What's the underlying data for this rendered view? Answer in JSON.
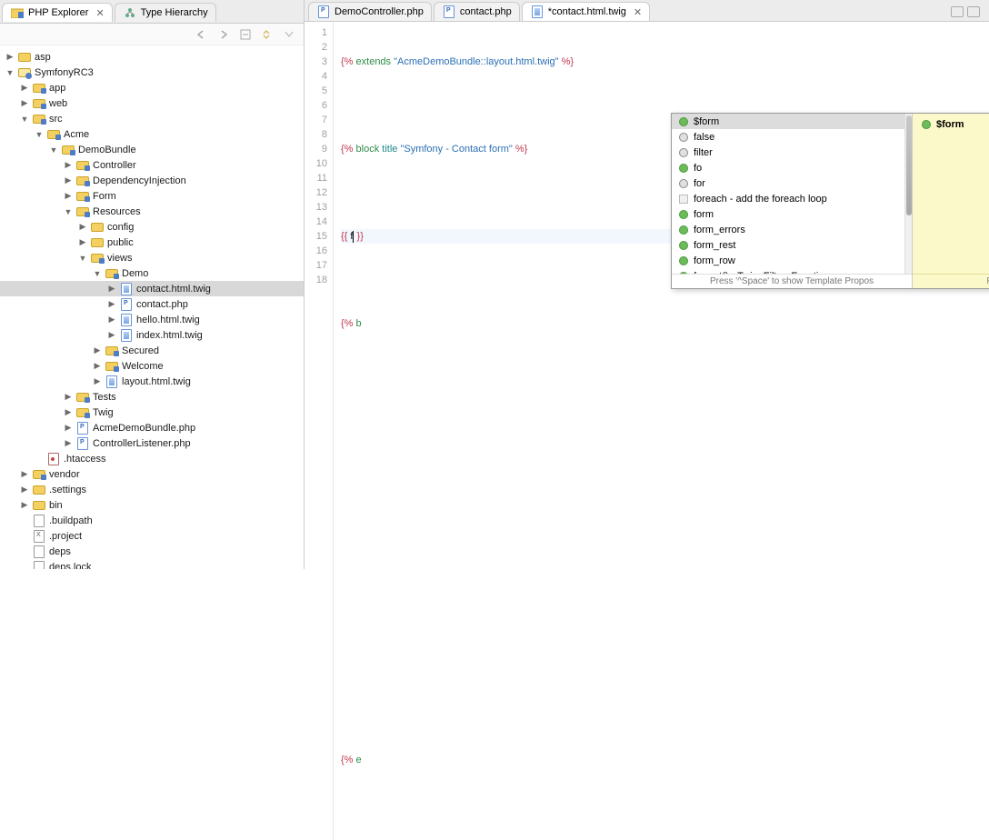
{
  "left": {
    "tabs": [
      {
        "label": "PHP Explorer",
        "active": true
      },
      {
        "label": "Type Hierarchy",
        "active": false
      }
    ],
    "tree": [
      {
        "d": 0,
        "arrow": "▶",
        "icon": "folder-closed",
        "label": "asp"
      },
      {
        "d": 0,
        "arrow": "▼",
        "icon": "proj-icon",
        "label": "SymfonyRC3"
      },
      {
        "d": 1,
        "arrow": "▶",
        "icon": "php-folder",
        "label": "app"
      },
      {
        "d": 1,
        "arrow": "▶",
        "icon": "php-folder",
        "label": "web"
      },
      {
        "d": 1,
        "arrow": "▼",
        "icon": "php-folder",
        "label": "src"
      },
      {
        "d": 2,
        "arrow": "▼",
        "icon": "php-folder",
        "label": "Acme"
      },
      {
        "d": 3,
        "arrow": "▼",
        "icon": "php-folder",
        "label": "DemoBundle"
      },
      {
        "d": 4,
        "arrow": "▶",
        "icon": "php-folder",
        "label": "Controller"
      },
      {
        "d": 4,
        "arrow": "▶",
        "icon": "php-folder",
        "label": "DependencyInjection"
      },
      {
        "d": 4,
        "arrow": "▶",
        "icon": "php-folder",
        "label": "Form"
      },
      {
        "d": 4,
        "arrow": "▼",
        "icon": "php-folder",
        "label": "Resources"
      },
      {
        "d": 5,
        "arrow": "▶",
        "icon": "folder-closed",
        "label": "config"
      },
      {
        "d": 5,
        "arrow": "▶",
        "icon": "folder-closed",
        "label": "public"
      },
      {
        "d": 5,
        "arrow": "▼",
        "icon": "php-folder",
        "label": "views"
      },
      {
        "d": 6,
        "arrow": "▼",
        "icon": "php-folder",
        "label": "Demo"
      },
      {
        "d": 7,
        "arrow": "▶",
        "icon": "file-t",
        "label": "contact.html.twig",
        "selected": true
      },
      {
        "d": 7,
        "arrow": "▶",
        "icon": "file-p",
        "label": "contact.php"
      },
      {
        "d": 7,
        "arrow": "▶",
        "icon": "file-t",
        "label": "hello.html.twig"
      },
      {
        "d": 7,
        "arrow": "▶",
        "icon": "file-t",
        "label": "index.html.twig"
      },
      {
        "d": 6,
        "arrow": "▶",
        "icon": "php-folder",
        "label": "Secured"
      },
      {
        "d": 6,
        "arrow": "▶",
        "icon": "php-folder",
        "label": "Welcome"
      },
      {
        "d": 6,
        "arrow": "▶",
        "icon": "file-t",
        "label": "layout.html.twig"
      },
      {
        "d": 4,
        "arrow": "▶",
        "icon": "php-folder",
        "label": "Tests"
      },
      {
        "d": 4,
        "arrow": "▶",
        "icon": "php-folder",
        "label": "Twig"
      },
      {
        "d": 4,
        "arrow": "▶",
        "icon": "file-p",
        "label": "AcmeDemoBundle.php"
      },
      {
        "d": 4,
        "arrow": "▶",
        "icon": "file-p",
        "label": "ControllerListener.php"
      },
      {
        "d": 2,
        "arrow": "",
        "icon": "dot-file",
        "label": ".htaccess"
      },
      {
        "d": 1,
        "arrow": "▶",
        "icon": "php-folder",
        "label": "vendor"
      },
      {
        "d": 1,
        "arrow": "▶",
        "icon": "folder-closed",
        "label": ".settings"
      },
      {
        "d": 1,
        "arrow": "▶",
        "icon": "folder-closed",
        "label": "bin"
      },
      {
        "d": 1,
        "arrow": "",
        "icon": "file-generic",
        "label": ".buildpath"
      },
      {
        "d": 1,
        "arrow": "",
        "icon": "file-x",
        "label": ".project"
      },
      {
        "d": 1,
        "arrow": "",
        "icon": "file-generic",
        "label": "deps"
      },
      {
        "d": 1,
        "arrow": "",
        "icon": "file-generic",
        "label": "deps.lock"
      }
    ]
  },
  "editor": {
    "tabs": [
      {
        "label": "DemoController.php",
        "active": false,
        "icon": "file-p"
      },
      {
        "label": "contact.php",
        "active": false,
        "icon": "file-p"
      },
      {
        "label": "*contact.html.twig",
        "active": true,
        "icon": "file-t"
      }
    ],
    "code": {
      "line1_a": "{%",
      "line1_b": " extends ",
      "line1_c": "\"AcmeDemoBundle::layout.html.twig\"",
      "line1_d": " %}",
      "line3_a": "{%",
      "line3_b": " block ",
      "line3_c": "title ",
      "line3_d": "\"Symfony - Contact form\"",
      "line3_e": " %}",
      "line5_a": "{{",
      "line5_b": " f",
      "line5_c": " }}",
      "line7_a": "{%",
      "line7_b": " b",
      "line17_a": "{%",
      "line17_b": " e"
    },
    "line_count": 18
  },
  "autocomplete": {
    "items": [
      {
        "kind": "green",
        "label": "$form"
      },
      {
        "kind": "gray",
        "label": "false"
      },
      {
        "kind": "gray",
        "label": "filter"
      },
      {
        "kind": "green",
        "label": "fo"
      },
      {
        "kind": "gray",
        "label": "for"
      },
      {
        "kind": "square",
        "label": "foreach - add the foreach loop"
      },
      {
        "kind": "green",
        "label": "form"
      },
      {
        "kind": "green",
        "label": "form_errors"
      },
      {
        "kind": "green",
        "label": "form_rest"
      },
      {
        "kind": "green",
        "label": "form_row"
      },
      {
        "kind": "green",
        "label": "format() - Twig_Filter_Function"
      }
    ],
    "hint": "Press '^Space' to show Template Propos",
    "doc_title": "$form",
    "doc_hint": "Press 'Tab' from proposal table or click for focus"
  }
}
